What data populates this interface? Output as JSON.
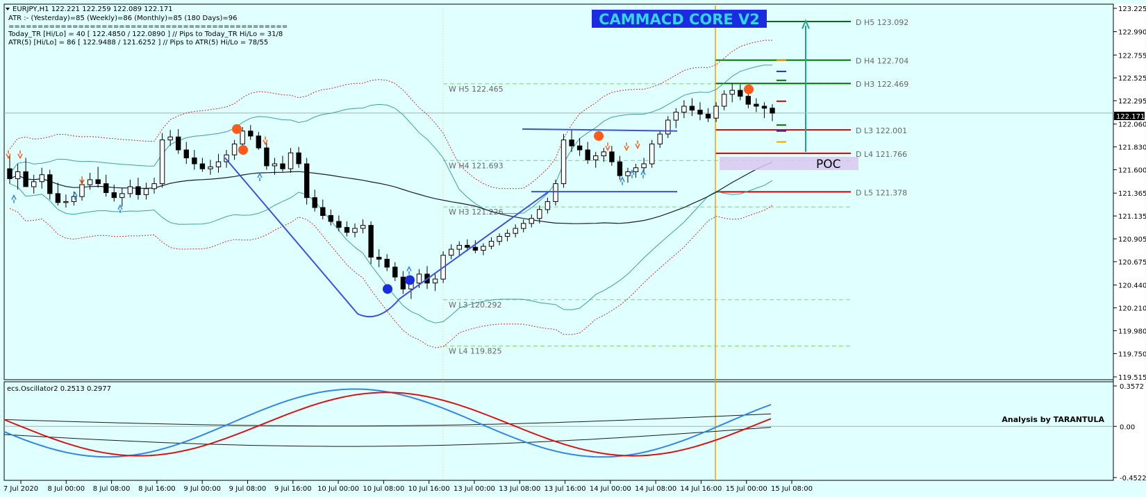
{
  "header": {
    "symbol_line": "EURJPY,H1  122.221 122.259 122.089 122.171",
    "atr_line": "ATR :- (Yesterday)=85      (Weekly)=86      (Monthly)=85      (180 Days)=96",
    "separator": "================================================",
    "today_tr_line": "Today_TR [Hi/Lo] = 40 [ 122.4850 / 122.0890 ]  // Pips to Today_TR Hi/Lo  = 31/8",
    "atr5_line": "ATR(5)     [Hi/Lo] = 86 [ 122.9488 / 121.6252 ]  // Pips to ATR(5) Hi/Lo     = 78/55"
  },
  "brand": {
    "title": "CAMMACD CORE V2"
  },
  "colors": {
    "background": "#e0ffff",
    "grid": "#d9d9d9",
    "bull_candle": "#ffffff",
    "bear_candle": "#000000",
    "bollinger": "#3aa0a0",
    "moving_average": "#1a1a2e",
    "weekly_level": "#7fd07f",
    "daily_resistance": "#007000",
    "daily_support": "#d00000",
    "pattern_line": "#3c50e0",
    "session_line": "#f5a000",
    "oscillator_fast": "#2f86e6",
    "oscillator_slow": "#dd1111"
  },
  "y_axis": {
    "ticks": [
      "123.225",
      "122.990",
      "122.755",
      "122.525",
      "122.295",
      "122.060",
      "121.830",
      "121.600",
      "121.365",
      "121.135",
      "120.905",
      "120.675",
      "120.440",
      "120.210",
      "119.980",
      "119.750",
      "119.515"
    ],
    "current_price": "122.171"
  },
  "x_axis": {
    "ticks": [
      "7 Jul 2020",
      "8 Jul 00:00",
      "8 Jul 08:00",
      "8 Jul 16:00",
      "9 Jul 00:00",
      "9 Jul 08:00",
      "9 Jul 16:00",
      "10 Jul 00:00",
      "10 Jul 08:00",
      "10 Jul 16:00",
      "13 Jul 00:00",
      "13 Jul 08:00",
      "13 Jul 16:00",
      "14 Jul 00:00",
      "14 Jul 08:00",
      "14 Jul 16:00",
      "15 Jul 00:00",
      "15 Jul 08:00"
    ]
  },
  "levels": {
    "weekly": [
      {
        "label": "W  H5 122.465",
        "price": 122.465
      },
      {
        "label": "W  H4 121.693",
        "price": 121.693
      },
      {
        "label": "W  H3 121.226",
        "price": 121.226
      },
      {
        "label": "W  L3 120.292",
        "price": 120.292
      },
      {
        "label": "W  L4 119.825",
        "price": 119.825
      }
    ],
    "daily": [
      {
        "label": "D  H5 123.092",
        "price": 123.092,
        "kind": "resistance"
      },
      {
        "label": "D  H4 122.704",
        "price": 122.704,
        "kind": "resistance"
      },
      {
        "label": "D  H3 122.469",
        "price": 122.469,
        "kind": "resistance"
      },
      {
        "label": "D  L3 122.001",
        "price": 122.001,
        "kind": "support"
      },
      {
        "label": "D  L4 121.766",
        "price": 121.766,
        "kind": "support"
      },
      {
        "label": "D  L5 121.378",
        "price": 121.378,
        "kind": "support"
      }
    ],
    "poc_label": "POC"
  },
  "oscillator": {
    "title": "ecs.Oscillator2 0.2513 0.2977",
    "ticks": [
      "0.3572",
      "0.00",
      "-0.4522"
    ],
    "credit": "Analysis by TARANTULA"
  },
  "chart_data": {
    "type": "candlestick",
    "symbol": "EURJPY",
    "timeframe": "H1",
    "ylim": [
      119.515,
      123.225
    ],
    "open_high_low_close": [
      122.221,
      122.259,
      122.089,
      122.171
    ],
    "candles": [
      [
        121.61,
        121.75,
        121.46,
        121.51
      ],
      [
        121.51,
        121.66,
        121.4,
        121.58
      ],
      [
        121.58,
        121.72,
        121.47,
        121.43
      ],
      [
        121.43,
        121.55,
        121.36,
        121.48
      ],
      [
        121.48,
        121.62,
        121.41,
        121.55
      ],
      [
        121.55,
        121.6,
        121.3,
        121.36
      ],
      [
        121.36,
        121.47,
        121.24,
        121.27
      ],
      [
        121.27,
        121.35,
        121.22,
        121.28
      ],
      [
        121.28,
        121.38,
        121.24,
        121.33
      ],
      [
        121.33,
        121.5,
        121.29,
        121.45
      ],
      [
        121.45,
        121.57,
        121.4,
        121.5
      ],
      [
        121.5,
        121.63,
        121.42,
        121.46
      ],
      [
        121.46,
        121.55,
        121.33,
        121.37
      ],
      [
        121.37,
        121.45,
        121.28,
        121.32
      ],
      [
        121.32,
        121.42,
        121.23,
        121.36
      ],
      [
        121.36,
        121.5,
        121.32,
        121.43
      ],
      [
        121.43,
        121.52,
        121.3,
        121.35
      ],
      [
        121.35,
        121.47,
        121.3,
        121.41
      ],
      [
        121.41,
        121.52,
        121.36,
        121.46
      ],
      [
        121.46,
        121.97,
        121.42,
        121.9
      ],
      [
        121.9,
        122.0,
        121.84,
        121.93
      ],
      [
        121.93,
        122.01,
        121.76,
        121.8
      ],
      [
        121.8,
        121.88,
        121.66,
        121.72
      ],
      [
        121.72,
        121.8,
        121.6,
        121.66
      ],
      [
        121.66,
        121.72,
        121.58,
        121.61
      ],
      [
        121.61,
        121.7,
        121.55,
        121.63
      ],
      [
        121.63,
        121.76,
        121.57,
        121.68
      ],
      [
        121.68,
        121.8,
        121.62,
        121.75
      ],
      [
        121.75,
        121.9,
        121.7,
        121.86
      ],
      [
        121.86,
        122.03,
        121.82,
        121.99
      ],
      [
        121.99,
        122.05,
        121.9,
        121.94
      ],
      [
        121.94,
        121.98,
        121.8,
        121.82
      ],
      [
        121.82,
        121.87,
        121.6,
        121.64
      ],
      [
        121.64,
        121.72,
        121.55,
        121.66
      ],
      [
        121.66,
        121.74,
        121.58,
        121.61
      ],
      [
        121.61,
        121.82,
        121.57,
        121.77
      ],
      [
        121.77,
        121.83,
        121.62,
        121.66
      ],
      [
        121.66,
        121.72,
        121.25,
        121.32
      ],
      [
        121.32,
        121.4,
        121.18,
        121.22
      ],
      [
        121.22,
        121.3,
        121.1,
        121.14
      ],
      [
        121.14,
        121.2,
        121.04,
        121.08
      ],
      [
        121.08,
        121.14,
        120.98,
        121.02
      ],
      [
        121.02,
        121.08,
        120.93,
        120.97
      ],
      [
        120.97,
        121.06,
        120.92,
        121.01
      ],
      [
        121.01,
        121.1,
        120.96,
        121.04
      ],
      [
        121.04,
        121.08,
        120.65,
        120.72
      ],
      [
        120.72,
        120.8,
        120.62,
        120.7
      ],
      [
        120.7,
        120.75,
        120.58,
        120.62
      ],
      [
        120.62,
        120.67,
        120.48,
        120.52
      ],
      [
        120.52,
        120.58,
        120.35,
        120.4
      ],
      [
        120.4,
        120.52,
        120.3,
        120.46
      ],
      [
        120.46,
        120.6,
        120.41,
        120.55
      ],
      [
        120.55,
        120.63,
        120.4,
        120.46
      ],
      [
        120.46,
        120.55,
        120.38,
        120.5
      ],
      [
        120.5,
        120.78,
        120.46,
        120.74
      ],
      [
        120.74,
        120.85,
        120.7,
        120.8
      ],
      [
        120.8,
        120.88,
        120.74,
        120.84
      ],
      [
        120.84,
        120.9,
        120.78,
        120.82
      ],
      [
        120.82,
        120.89,
        120.76,
        120.79
      ],
      [
        120.79,
        120.86,
        120.74,
        120.83
      ],
      [
        120.83,
        120.92,
        120.8,
        120.88
      ],
      [
        120.88,
        120.96,
        120.84,
        120.93
      ],
      [
        120.93,
        121.0,
        120.88,
        120.96
      ],
      [
        120.96,
        121.05,
        120.92,
        121.01
      ],
      [
        121.01,
        121.1,
        120.97,
        121.06
      ],
      [
        121.06,
        121.15,
        121.02,
        121.11
      ],
      [
        121.11,
        121.24,
        121.06,
        121.2
      ],
      [
        121.2,
        121.32,
        121.16,
        121.28
      ],
      [
        121.28,
        121.5,
        121.24,
        121.46
      ],
      [
        121.46,
        121.96,
        121.42,
        121.9
      ],
      [
        121.9,
        122.0,
        121.78,
        121.84
      ],
      [
        121.84,
        121.92,
        121.74,
        121.8
      ],
      [
        121.8,
        121.88,
        121.66,
        121.7
      ],
      [
        121.7,
        121.78,
        121.62,
        121.74
      ],
      [
        121.74,
        121.82,
        121.68,
        121.78
      ],
      [
        121.78,
        121.84,
        121.64,
        121.68
      ],
      [
        121.68,
        121.74,
        121.5,
        121.54
      ],
      [
        121.54,
        121.62,
        121.47,
        121.58
      ],
      [
        121.58,
        121.66,
        121.52,
        121.62
      ],
      [
        121.62,
        121.72,
        121.56,
        121.66
      ],
      [
        121.66,
        121.9,
        121.62,
        121.86
      ],
      [
        121.86,
        122.0,
        121.82,
        121.96
      ],
      [
        121.96,
        122.14,
        121.92,
        122.1
      ],
      [
        122.1,
        122.22,
        122.02,
        122.18
      ],
      [
        122.18,
        122.3,
        122.12,
        122.24
      ],
      [
        122.24,
        122.32,
        122.14,
        122.2
      ],
      [
        122.2,
        122.28,
        122.1,
        122.16
      ],
      [
        122.16,
        122.22,
        122.08,
        122.12
      ],
      [
        122.12,
        122.28,
        122.08,
        122.24
      ],
      [
        122.24,
        122.4,
        122.2,
        122.36
      ],
      [
        122.36,
        122.47,
        122.28,
        122.4
      ],
      [
        122.4,
        122.46,
        122.3,
        122.34
      ],
      [
        122.34,
        122.4,
        122.22,
        122.26
      ],
      [
        122.26,
        122.32,
        122.18,
        122.24
      ],
      [
        122.24,
        122.28,
        122.12,
        122.22
      ],
      [
        122.22,
        122.26,
        122.09,
        122.17
      ]
    ],
    "series": []
  }
}
